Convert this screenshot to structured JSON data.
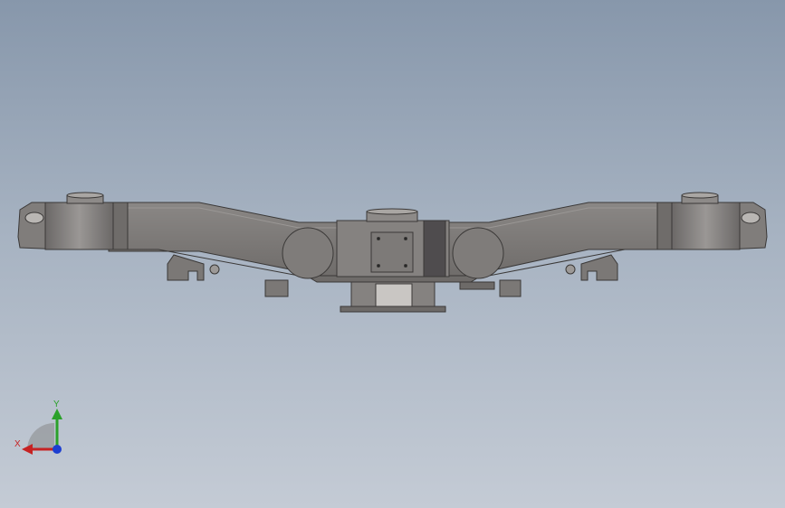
{
  "viewport": {
    "background_top": "#8797ab",
    "background_bottom": "#c4cbd5",
    "model_color": "#7a7775"
  },
  "triad": {
    "x_label": "X",
    "y_label": "Y",
    "x_color": "#c62222",
    "y_color": "#2aa12a",
    "z_color": "#1d3fd1"
  }
}
